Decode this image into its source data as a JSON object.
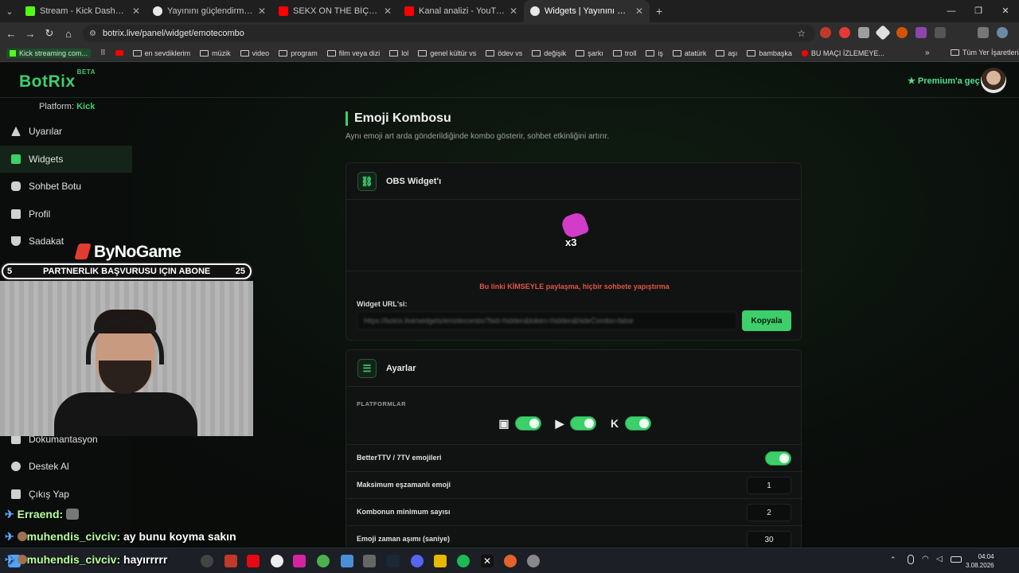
{
  "browser": {
    "tabs": [
      {
        "title": "Stream - Kick Dashboard",
        "color": "#53fc18"
      },
      {
        "title": "Yayınını güçlendirmek için e",
        "color": "#ffffff"
      },
      {
        "title": "SEKX ON THE BİÇ | Madara Old",
        "color": "#ff0000"
      },
      {
        "title": "Kanal analizi - YouTube Studio",
        "color": "#ff0000"
      },
      {
        "title": "Widgets | Yayınını güçlendirmek",
        "color": "#ffffff"
      }
    ],
    "new_tab": "+",
    "url": "botrix.live/panel/widget/emotecombo",
    "bookmarks": [
      "Kick streaming com...",
      "en sevdiklerim",
      "müzik",
      "video",
      "program",
      "film veya dizi",
      "lol",
      "genel kültür vs",
      "ödev vs",
      "değişik",
      "şarkı",
      "troll",
      "iş",
      "atatürk",
      "aşı",
      "bambaşka",
      "BU MAÇI İZLEMEYE..."
    ],
    "all_bookmarks": "Tüm Yer İşaretleri"
  },
  "app": {
    "logo": "BotRix",
    "logo_badge": "BETA",
    "premium": "Premium'a geç",
    "platform_label": "Platform:",
    "platform_value": "Kick",
    "sidebar": [
      "Uyarılar",
      "Widgets",
      "Sohbet Botu",
      "Profil",
      "Sadakat",
      "Dokumantasyon",
      "Destek Al",
      "Çıkış Yap"
    ]
  },
  "main": {
    "title": "Emoji Kombosu",
    "description": "Aynı emoji art arda gönderildiğinde kombo gösterir, sohbet etkinliğini artırır.",
    "obs_title": "OBS Widget'ı",
    "combo_text": "x3",
    "warning": "Bu linki KİMSEYLE paylaşma, hiçbir sohbete yapıştırma",
    "url_label": "Widget URL'si:",
    "url_value": "https://botrix.live/widgets/emotecombo?bid=hidden&token=hidden&hideCombo=false",
    "copy": "Kopyala",
    "settings_title": "Ayarlar",
    "platforms_label": "PLATFORMLAR",
    "settings": [
      {
        "label": "BetterTTV / 7TV emojileri",
        "value": null
      },
      {
        "label": "Maksimum eşzamanlı emoji",
        "value": "1"
      },
      {
        "label": "Kombonun minimum sayısı",
        "value": "2"
      },
      {
        "label": "Emoji zaman aşımı (saniye)",
        "value": "30"
      }
    ]
  },
  "overlay": {
    "brand": "ByNoGame",
    "banner_left": "5",
    "banner_text": "PARTNERLIK BAŞVURUSU IÇIN ABONE",
    "banner_right": "25",
    "chat": [
      {
        "user": "Erraend:",
        "msg": ""
      },
      {
        "user": "muhendis_civciv:",
        "msg": "ay bunu koyma sakın"
      },
      {
        "user": "muhendis_civciv:",
        "msg": "hayırrrrr"
      }
    ]
  },
  "taskbar": {
    "time": "04:04",
    "date": "3.08.2026"
  },
  "colors": {
    "accent": "#3ccf6a",
    "warning": "#e2554a"
  }
}
